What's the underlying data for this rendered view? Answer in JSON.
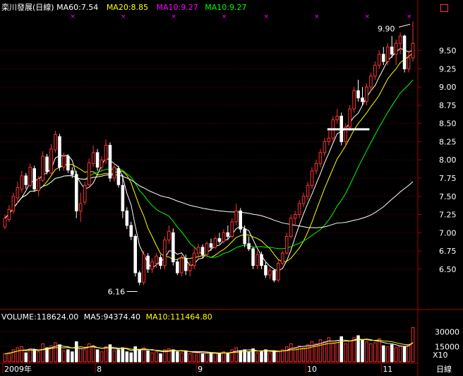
{
  "header": {
    "title": "栾川發展(日線)",
    "ma60": "MA60:7.54",
    "ma20": "MA20:8.85",
    "ma10": "MA10:9.27",
    "ma10b": "MA10:9.27"
  },
  "volume_header": {
    "label": "VOLUME:118624.00",
    "ma5": "MA5:94374.40",
    "ma10": "MA10:111464.80"
  },
  "colors": {
    "background": "#000000",
    "up": "#ff3232",
    "down": "#ffffff",
    "ma5": "#ffffff",
    "ma10": "#ffff00",
    "ma20": "#00ff00",
    "ma60": "#ffffff",
    "grid": "#7a0000",
    "axis_text": "#ffffff",
    "magenta": "#ff00ff"
  },
  "chart_data": {
    "type": "candlestick",
    "price_axis": {
      "ylim": [
        6.12,
        10.02
      ],
      "ticks": [
        6.5,
        6.75,
        7.0,
        7.25,
        7.5,
        7.75,
        8.0,
        8.25,
        8.5,
        8.75,
        9.0,
        9.25,
        9.5
      ]
    },
    "volume_axis": {
      "ylim": [
        0,
        40000
      ],
      "ticks": [
        15000,
        30000
      ],
      "multiplier_label": "X10"
    },
    "x_labels": [
      {
        "text": "2009年",
        "index": 0
      },
      {
        "text": "8",
        "index": 22
      },
      {
        "text": "9",
        "index": 46
      },
      {
        "text": "10",
        "index": 72
      },
      {
        "text": "11",
        "index": 90
      }
    ],
    "bottom_label": "日線",
    "annotations": {
      "high": "9.90",
      "low": "6.16"
    },
    "candles": [
      [
        7.08,
        7.25,
        7.05,
        7.2
      ],
      [
        7.18,
        7.38,
        7.15,
        7.32
      ],
      [
        7.3,
        7.55,
        7.26,
        7.5
      ],
      [
        7.48,
        7.7,
        7.4,
        7.62
      ],
      [
        7.6,
        7.85,
        7.55,
        7.78
      ],
      [
        7.78,
        7.82,
        7.6,
        7.66
      ],
      [
        7.65,
        7.95,
        7.62,
        7.9
      ],
      [
        7.88,
        7.92,
        7.56,
        7.6
      ],
      [
        7.58,
        7.78,
        7.5,
        7.74
      ],
      [
        7.72,
        8.12,
        7.7,
        8.05
      ],
      [
        8.04,
        8.08,
        7.8,
        7.84
      ],
      [
        7.82,
        8.22,
        7.8,
        8.15
      ],
      [
        8.14,
        8.4,
        8.1,
        8.35
      ],
      [
        8.32,
        8.36,
        7.85,
        7.9
      ],
      [
        7.9,
        8.1,
        7.85,
        8.05
      ],
      [
        8.05,
        8.08,
        7.82,
        7.86
      ],
      [
        7.85,
        7.9,
        7.75,
        7.8
      ],
      [
        7.8,
        7.85,
        7.2,
        7.3
      ],
      [
        7.3,
        7.55,
        7.15,
        7.4
      ],
      [
        7.42,
        7.7,
        7.38,
        7.65
      ],
      [
        7.66,
        8.02,
        7.62,
        7.96
      ],
      [
        7.95,
        8.2,
        7.9,
        8.1
      ],
      [
        8.1,
        8.15,
        7.85,
        7.9
      ],
      [
        7.9,
        8.05,
        7.85,
        8.0
      ],
      [
        8.0,
        8.28,
        7.95,
        8.2
      ],
      [
        8.2,
        8.24,
        7.7,
        7.75
      ],
      [
        7.75,
        7.95,
        7.7,
        7.9
      ],
      [
        7.88,
        7.92,
        7.62,
        7.66
      ],
      [
        7.65,
        7.8,
        7.2,
        7.3
      ],
      [
        7.3,
        7.35,
        7.05,
        7.1
      ],
      [
        7.1,
        7.15,
        6.9,
        6.95
      ],
      [
        6.95,
        6.98,
        6.4,
        6.45
      ],
      [
        6.45,
        6.48,
        6.28,
        6.32
      ],
      [
        6.32,
        6.75,
        6.28,
        6.7
      ],
      [
        6.68,
        6.72,
        6.45,
        6.5
      ],
      [
        6.5,
        6.65,
        6.45,
        6.6
      ],
      [
        6.58,
        6.72,
        6.52,
        6.68
      ],
      [
        6.66,
        6.7,
        6.5,
        6.55
      ],
      [
        6.55,
        6.95,
        6.5,
        6.9
      ],
      [
        6.9,
        7.1,
        6.85,
        7.02
      ],
      [
        7.0,
        7.06,
        6.55,
        6.6
      ],
      [
        6.6,
        6.64,
        6.42,
        6.45
      ],
      [
        6.45,
        6.7,
        6.4,
        6.65
      ],
      [
        6.65,
        6.7,
        6.42,
        6.48
      ],
      [
        6.48,
        6.62,
        6.4,
        6.55
      ],
      [
        6.55,
        6.8,
        6.5,
        6.72
      ],
      [
        6.72,
        6.85,
        6.65,
        6.8
      ],
      [
        6.8,
        6.84,
        6.65,
        6.7
      ],
      [
        6.7,
        6.88,
        6.68,
        6.85
      ],
      [
        6.85,
        6.92,
        6.75,
        6.8
      ],
      [
        6.8,
        6.95,
        6.78,
        6.92
      ],
      [
        6.92,
        7.0,
        6.85,
        6.88
      ],
      [
        6.88,
        7.05,
        6.85,
        7.0
      ],
      [
        7.0,
        7.1,
        6.9,
        6.95
      ],
      [
        6.95,
        7.2,
        6.92,
        7.15
      ],
      [
        7.15,
        7.4,
        7.1,
        7.3
      ],
      [
        7.3,
        7.34,
        7.0,
        7.05
      ],
      [
        7.05,
        7.1,
        6.8,
        6.85
      ],
      [
        6.85,
        6.95,
        6.75,
        6.78
      ],
      [
        6.78,
        6.8,
        6.5,
        6.55
      ],
      [
        6.55,
        6.75,
        6.5,
        6.7
      ],
      [
        6.7,
        6.74,
        6.5,
        6.55
      ],
      [
        6.55,
        6.6,
        6.38,
        6.42
      ],
      [
        6.42,
        6.52,
        6.36,
        6.48
      ],
      [
        6.48,
        6.5,
        6.32,
        6.35
      ],
      [
        6.35,
        6.62,
        6.32,
        6.58
      ],
      [
        6.58,
        6.75,
        6.55,
        6.72
      ],
      [
        6.72,
        7.0,
        6.7,
        6.95
      ],
      [
        6.95,
        7.25,
        6.92,
        7.2
      ],
      [
        7.2,
        7.3,
        7.1,
        7.25
      ],
      [
        7.25,
        7.45,
        7.2,
        7.4
      ],
      [
        7.4,
        7.55,
        7.35,
        7.5
      ],
      [
        7.5,
        7.7,
        7.45,
        7.65
      ],
      [
        7.65,
        7.9,
        7.6,
        7.85
      ],
      [
        7.85,
        8.0,
        7.8,
        7.95
      ],
      [
        7.95,
        8.15,
        7.9,
        8.1
      ],
      [
        8.1,
        8.3,
        8.05,
        8.25
      ],
      [
        8.25,
        8.4,
        8.2,
        8.3
      ],
      [
        8.3,
        8.6,
        8.25,
        8.55
      ],
      [
        8.55,
        8.7,
        8.5,
        8.6
      ],
      [
        8.6,
        8.65,
        8.2,
        8.25
      ],
      [
        8.25,
        8.5,
        8.2,
        8.45
      ],
      [
        8.45,
        8.75,
        8.4,
        8.7
      ],
      [
        8.7,
        9.0,
        8.65,
        8.95
      ],
      [
        8.95,
        9.1,
        8.8,
        8.85
      ],
      [
        8.85,
        9.0,
        8.75,
        8.8
      ],
      [
        8.8,
        9.05,
        8.75,
        9.0
      ],
      [
        9.0,
        9.2,
        8.95,
        9.15
      ],
      [
        9.15,
        9.35,
        9.1,
        9.3
      ],
      [
        9.3,
        9.5,
        9.25,
        9.45
      ],
      [
        9.45,
        9.55,
        9.3,
        9.35
      ],
      [
        9.35,
        9.6,
        9.3,
        9.55
      ],
      [
        9.55,
        9.7,
        9.4,
        9.45
      ],
      [
        9.45,
        9.65,
        9.3,
        9.6
      ],
      [
        9.6,
        9.75,
        9.45,
        9.7
      ],
      [
        9.7,
        9.72,
        9.2,
        9.25
      ],
      [
        9.25,
        9.5,
        9.2,
        9.4
      ],
      [
        9.4,
        9.9,
        9.35,
        9.6
      ]
    ],
    "volumes": [
      8000,
      9000,
      12000,
      14000,
      15000,
      9000,
      13000,
      12000,
      10000,
      18000,
      14000,
      16000,
      19000,
      17000,
      11000,
      12000,
      10000,
      20000,
      13000,
      12000,
      18000,
      16000,
      12000,
      10000,
      15000,
      17000,
      11000,
      12000,
      14000,
      10000,
      9000,
      15000,
      12000,
      14000,
      11000,
      9000,
      10000,
      8000,
      12000,
      13000,
      12000,
      10000,
      9000,
      11000,
      8000,
      10000,
      9000,
      8000,
      9000,
      8000,
      9000,
      8000,
      10000,
      9000,
      12000,
      14000,
      11000,
      12000,
      10000,
      13000,
      9000,
      10000,
      12000,
      9000,
      11000,
      10000,
      12000,
      15000,
      18000,
      14000,
      16000,
      14000,
      17000,
      20000,
      18000,
      22000,
      20000,
      24000,
      19000,
      21000,
      25000,
      18000,
      21000,
      24000,
      26000,
      22000,
      20000,
      18000,
      19000,
      23000,
      16000,
      15000,
      17000,
      14000,
      16000,
      15000,
      17000,
      34000
    ]
  }
}
